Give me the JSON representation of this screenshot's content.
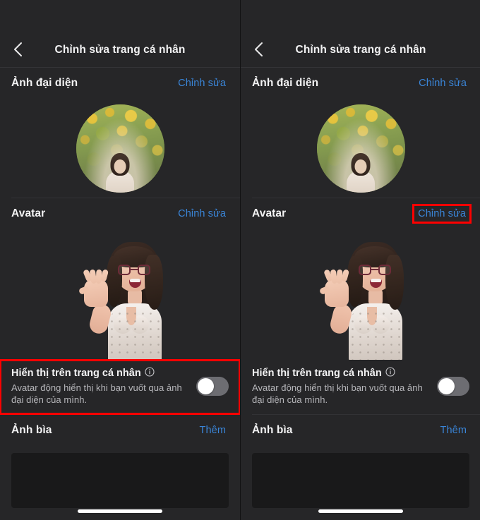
{
  "app": {
    "theme": "dark",
    "background_color": "#262628",
    "link_color": "#3a85d8",
    "highlight_color": "#ff0000"
  },
  "panels": [
    {
      "id": "left",
      "nav": {
        "back_icon": "chevron-left-icon",
        "title": "Chỉnh sửa trang cá nhân"
      },
      "profile_photo_section": {
        "title": "Ảnh đại diện",
        "action_label": "Chỉnh sửa",
        "action_highlighted": false,
        "image_alt": "Ảnh đại diện"
      },
      "avatar_section": {
        "title": "Avatar",
        "action_label": "Chỉnh sửa",
        "action_highlighted": false,
        "image_alt": "Avatar 3D"
      },
      "toggle_section": {
        "label": "Hiển thị trên trang cá nhân",
        "info_icon": "info-circle-icon",
        "description": "Avatar động hiển thị khi bạn vuốt qua ảnh đại diện của mình.",
        "state": "off",
        "highlighted": true
      },
      "cover_section": {
        "title": "Ảnh bìa",
        "action_label": "Thêm",
        "action_highlighted": false
      }
    },
    {
      "id": "right",
      "nav": {
        "back_icon": "chevron-left-icon",
        "title": "Chỉnh sửa trang cá nhân"
      },
      "profile_photo_section": {
        "title": "Ảnh đại diện",
        "action_label": "Chỉnh sửa",
        "action_highlighted": false,
        "image_alt": "Ảnh đại diện"
      },
      "avatar_section": {
        "title": "Avatar",
        "action_label": "Chỉnh sửa",
        "action_highlighted": true,
        "image_alt": "Avatar 3D"
      },
      "toggle_section": {
        "label": "Hiển thị trên trang cá nhân",
        "info_icon": "info-circle-icon",
        "description": "Avatar động hiển thị khi bạn vuốt qua ảnh đại diện của mình.",
        "state": "off",
        "highlighted": false
      },
      "cover_section": {
        "title": "Ảnh bìa",
        "action_label": "Thêm",
        "action_highlighted": false
      }
    }
  ]
}
